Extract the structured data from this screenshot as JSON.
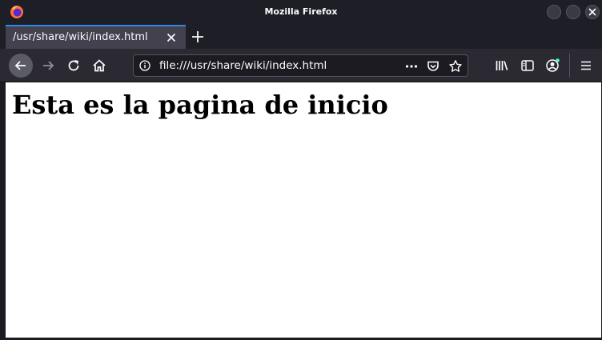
{
  "window": {
    "title": "Mozilla Firefox"
  },
  "tabs": [
    {
      "label": "/usr/share/wiki/index.html",
      "active": true
    }
  ],
  "urlbar": {
    "value": "file:///usr/share/wiki/index.html"
  },
  "page": {
    "heading": "Esta es la pagina de inicio"
  },
  "colors": {
    "accent": "#2e89e6",
    "chrome_bg": "#1e1e26",
    "toolbar_bg": "#2b2a33",
    "content_bg": "#ffffff"
  }
}
